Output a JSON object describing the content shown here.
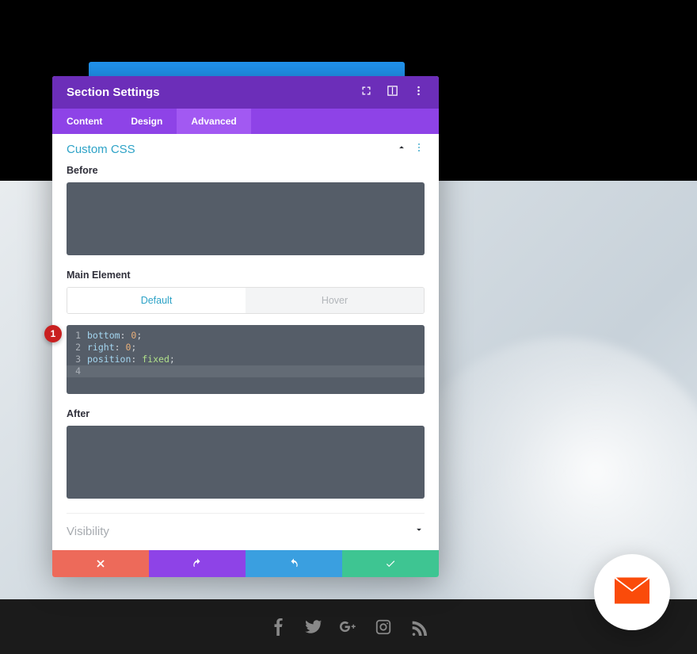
{
  "modal": {
    "title": "Section Settings",
    "tabs": [
      {
        "label": "Content"
      },
      {
        "label": "Design"
      },
      {
        "label": "Advanced"
      }
    ],
    "active_tab": "Advanced"
  },
  "custom_css": {
    "title": "Custom CSS",
    "before_label": "Before",
    "before_value": "",
    "main_label": "Main Element",
    "toggler": {
      "default": "Default",
      "hover": "Hover"
    },
    "code_lines": [
      {
        "n": "1",
        "prop": "bottom",
        "val": "0",
        "kind": "num"
      },
      {
        "n": "2",
        "prop": "right",
        "val": "0",
        "kind": "num"
      },
      {
        "n": "3",
        "prop": "position",
        "val": "fixed",
        "kind": "ident"
      },
      {
        "n": "4",
        "prop": "",
        "val": "",
        "kind": ""
      }
    ],
    "after_label": "After",
    "after_value": ""
  },
  "visibility": {
    "title": "Visibility"
  },
  "badge": "1",
  "colors": {
    "header": "#6c2eb9",
    "tabs": "#8e43e7",
    "accent": "#2ea3c7",
    "cancel": "#ed6a5a",
    "undo": "#8e43e7",
    "redo": "#3a9fe0",
    "confirm": "#3ec592"
  },
  "icons": {
    "expand": "expand-icon",
    "hover": "hover-icon",
    "more": "more-vertical-icon",
    "collapse": "chevron-up-icon",
    "expand_down": "chevron-down-icon",
    "close": "close-icon",
    "undo": "undo-icon",
    "redo": "redo-icon",
    "check": "check-icon",
    "mail": "mail-icon"
  }
}
